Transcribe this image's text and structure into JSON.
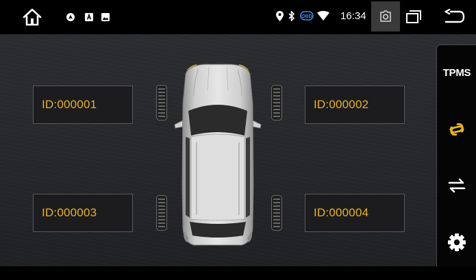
{
  "status_bar": {
    "time": "16:34",
    "obd_badge": "OBD",
    "icons": [
      "home-icon",
      "navigation-app-notification-icon",
      "text-app-notification-icon",
      "image-notification-icon",
      "location-pin-icon",
      "bluetooth-icon",
      "obd-icon",
      "wifi-icon",
      "screenshot-icon",
      "recent-apps-icon",
      "back-icon"
    ]
  },
  "tpms": {
    "sensors": [
      {
        "position": "front-left",
        "id_label": "ID:000001"
      },
      {
        "position": "front-right",
        "id_label": "ID:000002"
      },
      {
        "position": "rear-left",
        "id_label": "ID:000003"
      },
      {
        "position": "rear-right",
        "id_label": "ID:000004"
      }
    ]
  },
  "side_menu": {
    "items": [
      {
        "label": "TPMS",
        "icon": null
      },
      {
        "label": "",
        "icon": "link-icon"
      },
      {
        "label": "",
        "icon": "swap-icon"
      },
      {
        "label": "",
        "icon": "gear-icon"
      }
    ]
  },
  "colors": {
    "accent": "#e9b220",
    "background": "#2a2b2e",
    "box_background": "#1c1c1e",
    "box_border": "#5a5a5d",
    "status_bar": "#000000"
  }
}
